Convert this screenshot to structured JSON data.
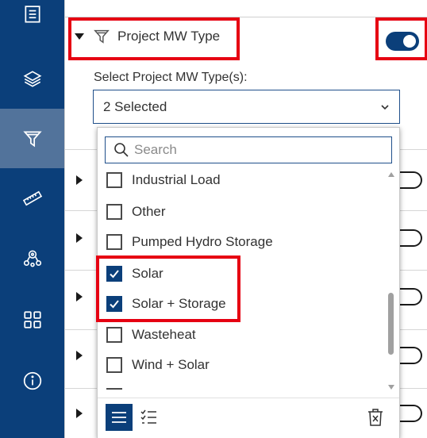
{
  "sidebar": {
    "items": [
      {
        "icon": "list-icon"
      },
      {
        "icon": "layers-icon"
      },
      {
        "icon": "filter-icon",
        "active": true
      },
      {
        "icon": "ruler-icon"
      },
      {
        "icon": "location-share-icon"
      },
      {
        "icon": "grid-icon"
      },
      {
        "icon": "info-icon"
      }
    ]
  },
  "filter": {
    "title": "Project MW Type",
    "enabled": true,
    "select_label": "Select Project MW Type(s):",
    "selected_summary": "2 Selected"
  },
  "dropdown": {
    "search_placeholder": "Search",
    "options": [
      {
        "label": "Industrial Load",
        "checked": false
      },
      {
        "label": "Other",
        "checked": false
      },
      {
        "label": "Pumped Hydro Storage",
        "checked": false
      },
      {
        "label": "Solar",
        "checked": true
      },
      {
        "label": "Solar + Storage",
        "checked": true
      },
      {
        "label": "Wasteheat",
        "checked": false
      },
      {
        "label": "Wind + Solar",
        "checked": false
      }
    ]
  },
  "colors": {
    "brand": "#0b3f7a",
    "highlight": "#e60012"
  }
}
